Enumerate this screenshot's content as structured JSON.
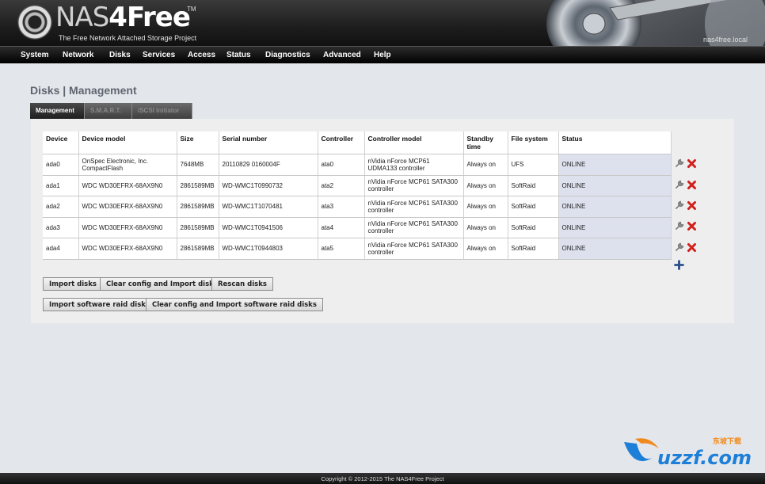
{
  "header": {
    "logo_thin": "NAS",
    "logo_bold": "4Free",
    "logo_tm": "TM",
    "subtitle": "The Free Network Attached Storage Project",
    "hostname": "nas4free.local"
  },
  "nav": [
    "System",
    "Network",
    "Disks",
    "Services",
    "Access",
    "Status",
    "Diagnostics",
    "Advanced",
    "Help"
  ],
  "page_title": "Disks | Management",
  "tabs": [
    "Management",
    "S.M.A.R.T.",
    "iSCSI Initiator"
  ],
  "table": {
    "headers": [
      "Device",
      "Device model",
      "Size",
      "Serial number",
      "Controller",
      "Controller model",
      "Standby time",
      "File system",
      "Status"
    ],
    "rows": [
      [
        "ada0",
        "OnSpec Electronic, Inc. CompactFlash",
        "7648MB",
        "20110829 0160004F",
        "ata0",
        "nVidia nForce MCP61 UDMA133 controller",
        "Always on",
        "UFS",
        "ONLINE"
      ],
      [
        "ada1",
        "WDC WD30EFRX-68AX9N0",
        "2861589MB",
        "WD-WMC1T0990732",
        "ata2",
        "nVidia nForce MCP61 SATA300 controller",
        "Always on",
        "SoftRaid",
        "ONLINE"
      ],
      [
        "ada2",
        "WDC WD30EFRX-68AX9N0",
        "2861589MB",
        "WD-WMC1T1070481",
        "ata3",
        "nVidia nForce MCP61 SATA300 controller",
        "Always on",
        "SoftRaid",
        "ONLINE"
      ],
      [
        "ada3",
        "WDC WD30EFRX-68AX9N0",
        "2861589MB",
        "WD-WMC1T0941506",
        "ata4",
        "nVidia nForce MCP61 SATA300 controller",
        "Always on",
        "SoftRaid",
        "ONLINE"
      ],
      [
        "ada4",
        "WDC WD30EFRX-68AX9N0",
        "2861589MB",
        "WD-WMC1T0944803",
        "ata5",
        "nVidia nForce MCP61 SATA300 controller",
        "Always on",
        "SoftRaid",
        "ONLINE"
      ]
    ]
  },
  "buttons": {
    "import_disks": "Import disks",
    "clear_import": "Clear config and Import disks",
    "rescan": "Rescan disks",
    "import_raid": "Import software raid disks",
    "clear_import_raid": "Clear config and Import software raid disks"
  },
  "icons": {
    "edit": "wrench-icon",
    "delete": "delete-x-icon",
    "add": "plus-icon"
  },
  "colors": {
    "delete_red": "#d0201c",
    "add_blue": "#2a4f8a",
    "status_bg": "#dde1ee"
  },
  "footer": "Copyright © 2012-2015 The NAS4Free Project",
  "watermark": "uzzf.com",
  "watermark_cn": "东坡下载"
}
